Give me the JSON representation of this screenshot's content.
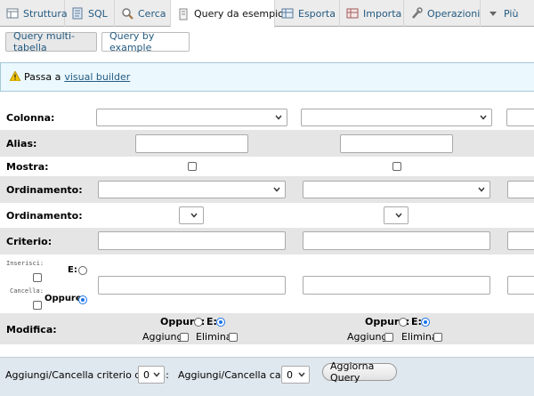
{
  "tabs": [
    {
      "label": "Struttura",
      "icon": "structure-icon"
    },
    {
      "label": "SQL",
      "icon": "sql-icon"
    },
    {
      "label": "Cerca",
      "icon": "search-icon"
    },
    {
      "label": "Query da esempio",
      "icon": "query-icon"
    },
    {
      "label": "Esporta",
      "icon": "export-icon"
    },
    {
      "label": "Importa",
      "icon": "import-icon"
    },
    {
      "label": "Operazioni",
      "icon": "wrench-icon"
    },
    {
      "label": "Più",
      "icon": "caret-down-icon"
    }
  ],
  "subtabs": [
    "Query multi-tabella",
    "Query by example"
  ],
  "notice": {
    "prefix": "Passa a",
    "link": "visual builder"
  },
  "rows": {
    "colonna": "Colonna:",
    "alias": "Alias:",
    "mostra": "Mostra:",
    "ordinamento1": "Ordinamento:",
    "ordinamento2": "Ordinamento:",
    "criterio": "Criterio:",
    "modifica": "Modifica:"
  },
  "insert": {
    "inserisci": "Inserisci:",
    "cancella": "Cancella:",
    "e": "E:",
    "oppure": "Oppure:"
  },
  "modify": {
    "oppure": "Oppure:",
    "e": "E:",
    "aggiungi": "Aggiungi",
    "elimina": "Elimina"
  },
  "footer": {
    "criteria_label": "Aggiungi/Cancella criterio di riga:",
    "criteria_value": "0",
    "fields_label": "Aggiungi/Cancella campi:",
    "fields_value": "0",
    "update_button": "Aggiorna Query"
  },
  "colors": {
    "link": "#235a81",
    "notice_bg": "#ebf8fd",
    "row_grey": "#e5e5e5"
  }
}
